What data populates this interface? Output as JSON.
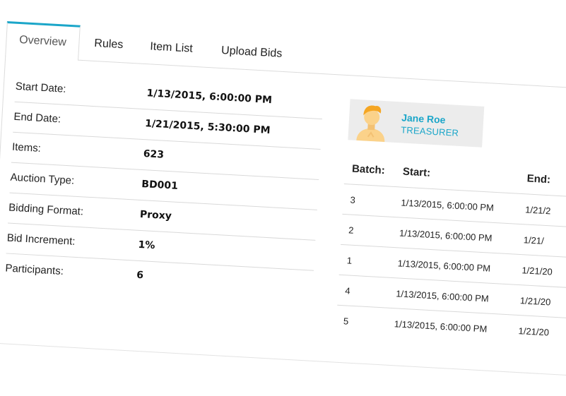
{
  "tabs": [
    {
      "label": "Overview",
      "active": true
    },
    {
      "label": "Rules",
      "active": false
    },
    {
      "label": "Item List",
      "active": false
    },
    {
      "label": "Upload Bids",
      "active": false
    }
  ],
  "details": [
    {
      "label": "Start Date:",
      "value": "1/13/2015, 6:00:00 PM"
    },
    {
      "label": "End Date:",
      "value": "1/21/2015, 5:30:00 PM"
    },
    {
      "label": "Items:",
      "value": "623"
    },
    {
      "label": "Auction Type:",
      "value": "BD001"
    },
    {
      "label": "Bidding Format:",
      "value": "Proxy"
    },
    {
      "label": "Bid Increment:",
      "value": "1%"
    },
    {
      "label": "Participants:",
      "value": "6"
    }
  ],
  "profile": {
    "name": "Jane Roe",
    "role": "TREASURER",
    "icon": "avatar-icon"
  },
  "batches": {
    "headers": {
      "batch": "Batch:",
      "start": "Start:",
      "end": "End:"
    },
    "rows": [
      {
        "batch": "3",
        "start": "1/13/2015, 6:00:00 PM",
        "end": "1/21/2"
      },
      {
        "batch": "2",
        "start": "1/13/2015, 6:00:00 PM",
        "end": "1/21/"
      },
      {
        "batch": "1",
        "start": "1/13/2015, 6:00:00 PM",
        "end": "1/21/20"
      },
      {
        "batch": "4",
        "start": "1/13/2015, 6:00:00 PM",
        "end": "1/21/20"
      },
      {
        "batch": "5",
        "start": "1/13/2015, 6:00:00 PM",
        "end": "1/21/20"
      }
    ]
  },
  "colors": {
    "accent": "#1ba6c9",
    "avatar_hair": "#f5a623",
    "avatar_skin": "#fbd28a"
  }
}
